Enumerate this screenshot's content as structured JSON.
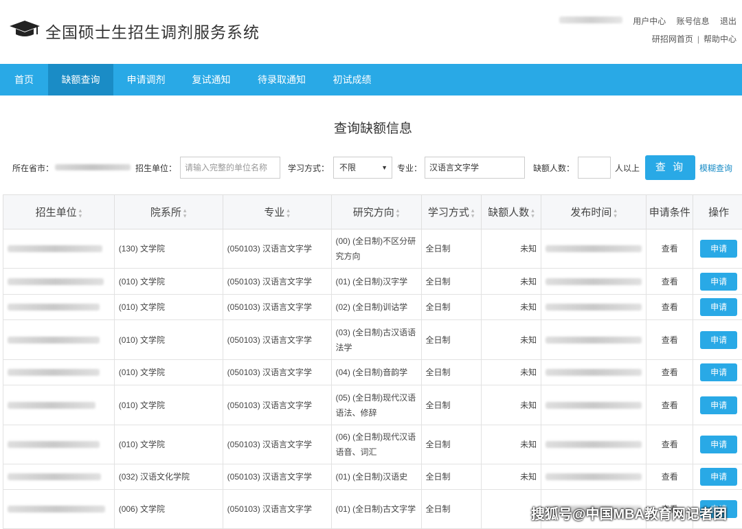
{
  "header": {
    "title": "全国硕士生招生调剂服务系统",
    "links": [
      "用户中心",
      "账号信息",
      "退出"
    ],
    "links2": [
      "研招网首页",
      "帮助中心"
    ]
  },
  "nav": [
    "首页",
    "缺额查询",
    "申请调剂",
    "复试通知",
    "待录取通知",
    "初试成绩"
  ],
  "query_title": "查询缺额信息",
  "filter": {
    "province_label": "所在省市：",
    "unit_label": "招生单位：",
    "unit_placeholder": "请输入完整的单位名称",
    "mode_label": "学习方式：",
    "mode_value": "不限",
    "major_label": "专业：",
    "major_value": "汉语言文字学",
    "vacancy_label": "缺额人数：",
    "vacancy_value": "",
    "vacancy_suffix": "人以上",
    "search_button": "查 询",
    "fuzzy_link": "模糊查询"
  },
  "table": {
    "headers": [
      "招生单位",
      "院系所",
      "专业",
      "研究方向",
      "学习方式",
      "缺额人数",
      "发布时间",
      "申请条件",
      "操作"
    ],
    "view_label": "查看",
    "apply_label": "申请",
    "rows": [
      {
        "dept": "(130) 文学院",
        "major": "(050103) 汉语言文字学",
        "dir": "(00) (全日制)不区分研究方向",
        "mode": "全日制",
        "count": "未知"
      },
      {
        "dept": "(010) 文学院",
        "major": "(050103) 汉语言文字学",
        "dir": "(01) (全日制)汉字学",
        "mode": "全日制",
        "count": "未知"
      },
      {
        "dept": "(010) 文学院",
        "major": "(050103) 汉语言文字学",
        "dir": "(02) (全日制)训诂学",
        "mode": "全日制",
        "count": "未知"
      },
      {
        "dept": "(010) 文学院",
        "major": "(050103) 汉语言文字学",
        "dir": "(03) (全日制)古汉语语法学",
        "mode": "全日制",
        "count": "未知"
      },
      {
        "dept": "(010) 文学院",
        "major": "(050103) 汉语言文字学",
        "dir": "(04) (全日制)音韵学",
        "mode": "全日制",
        "count": "未知"
      },
      {
        "dept": "(010) 文学院",
        "major": "(050103) 汉语言文字学",
        "dir": "(05) (全日制)现代汉语语法、修辞",
        "mode": "全日制",
        "count": "未知"
      },
      {
        "dept": "(010) 文学院",
        "major": "(050103) 汉语言文字学",
        "dir": "(06) (全日制)现代汉语语音、词汇",
        "mode": "全日制",
        "count": "未知"
      },
      {
        "dept": "(032) 汉语文化学院",
        "major": "(050103) 汉语言文字学",
        "dir": "(01) (全日制)汉语史",
        "mode": "全日制",
        "count": "未知"
      },
      {
        "dept": "(006) 文学院",
        "major": "(050103) 汉语言文字学",
        "dir": "(01) (全日制)古文字学",
        "mode": "全日制",
        "count": ""
      }
    ]
  },
  "watermark": "搜狐号@中国MBA教育网记者团",
  "colors": {
    "accent": "#29a9e6",
    "nav_active": "#1a8cc6"
  }
}
